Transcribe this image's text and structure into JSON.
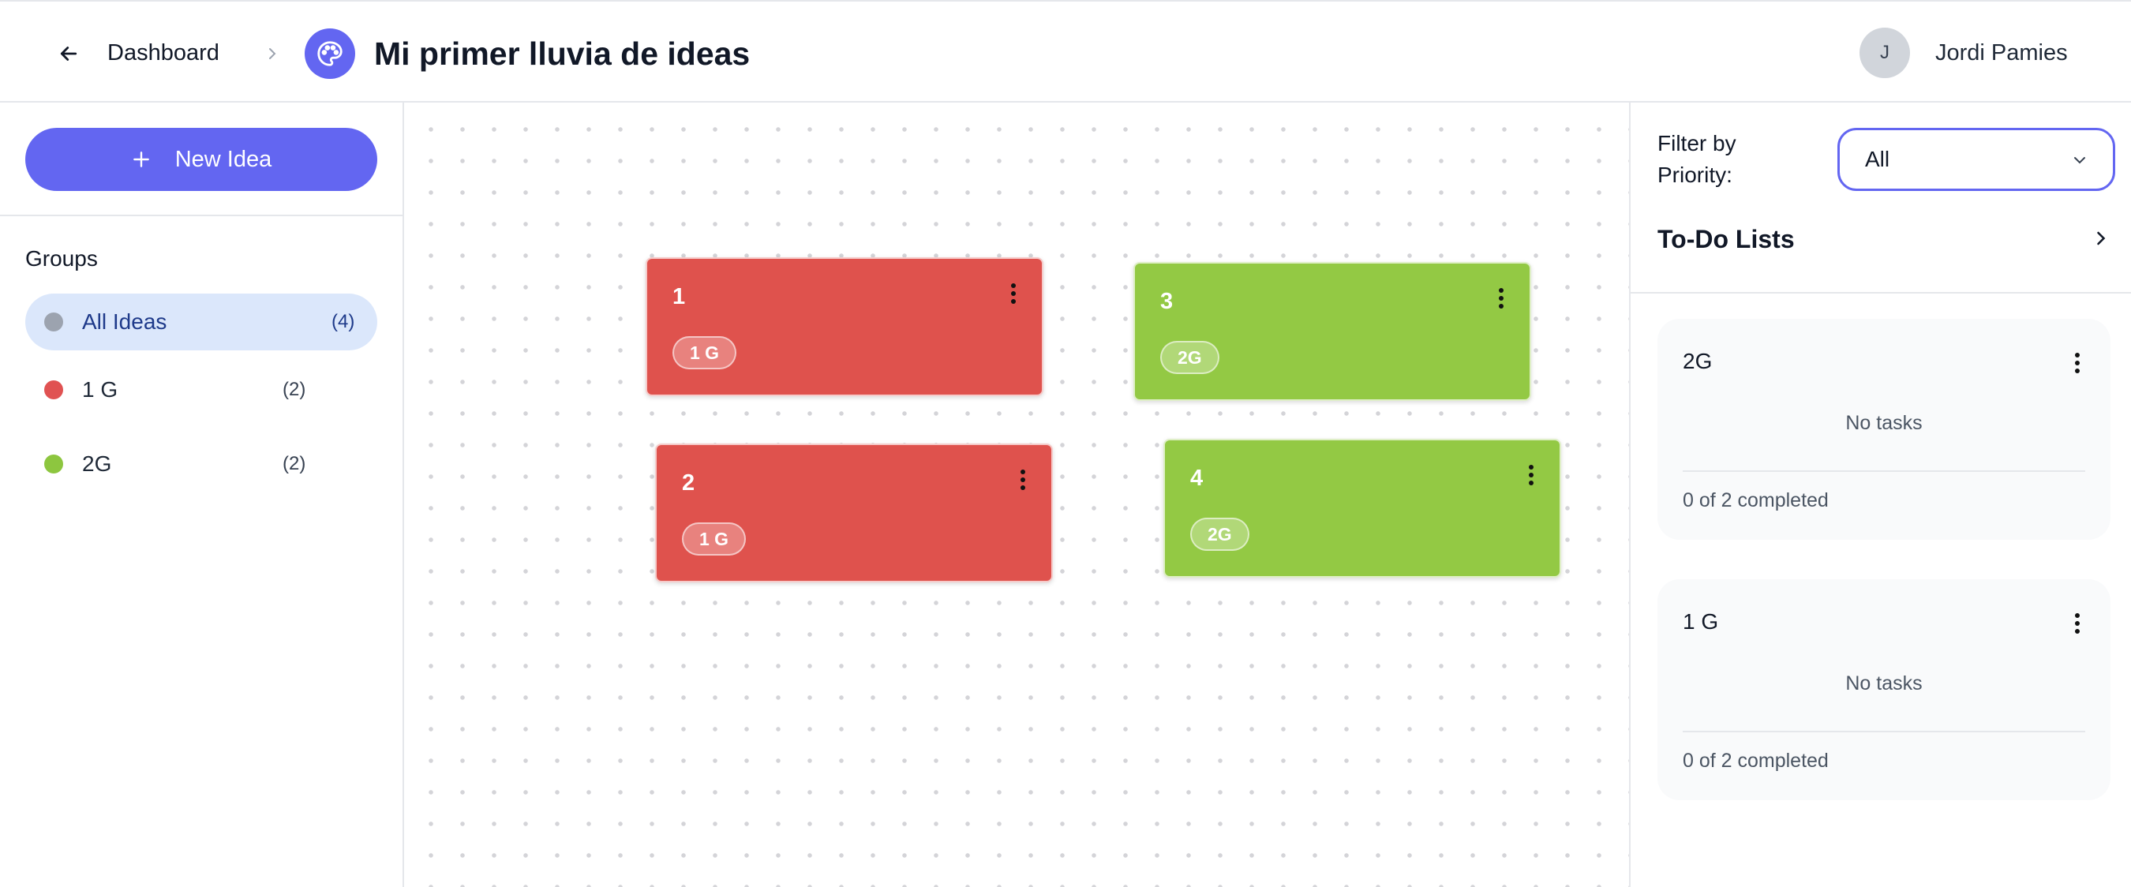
{
  "header": {
    "back_icon": "arrow-left-icon",
    "breadcrumb_link": "Dashboard",
    "separator_icon": "chevron-right-icon",
    "board_icon": "palette-icon",
    "title": "Mi primer lluvia de ideas",
    "user": {
      "initial": "J",
      "name": "Jordi Pamies"
    }
  },
  "sidebar": {
    "new_idea_label": "New Idea",
    "new_idea_icon": "plus-icon",
    "groups_title": "Groups",
    "groups": [
      {
        "label": "All Ideas",
        "count": "(4)",
        "color": "#9ca3af",
        "active": true
      },
      {
        "label": "1 G",
        "count": "(2)",
        "color": "#e05252",
        "active": false
      },
      {
        "label": "2G",
        "count": "(2)",
        "color": "#8dc63f",
        "active": false
      }
    ]
  },
  "canvas": {
    "ideas": [
      {
        "title": "1",
        "tag": "1 G",
        "color": "#df524d"
      },
      {
        "title": "3",
        "tag": "2G",
        "color": "#93c944"
      },
      {
        "title": "2",
        "tag": "1 G",
        "color": "#df524d"
      },
      {
        "title": "4",
        "tag": "2G",
        "color": "#93c944"
      }
    ]
  },
  "right_panel": {
    "filter_label": "Filter by Priority:",
    "filter_value": "All",
    "filter_icon": "chevron-down-icon",
    "todo_title": "To-Do Lists",
    "todo_icon": "chevron-right-icon",
    "todo_lists": [
      {
        "title": "2G",
        "empty": "No tasks",
        "progress": "0 of 2 completed"
      },
      {
        "title": "1 G",
        "empty": "No tasks",
        "progress": "0 of 2 completed"
      }
    ]
  },
  "colors": {
    "accent": "#6366f1",
    "active_group_bg": "#dbe7fb",
    "group_1g": "#df524d",
    "group_2g": "#93c944"
  }
}
